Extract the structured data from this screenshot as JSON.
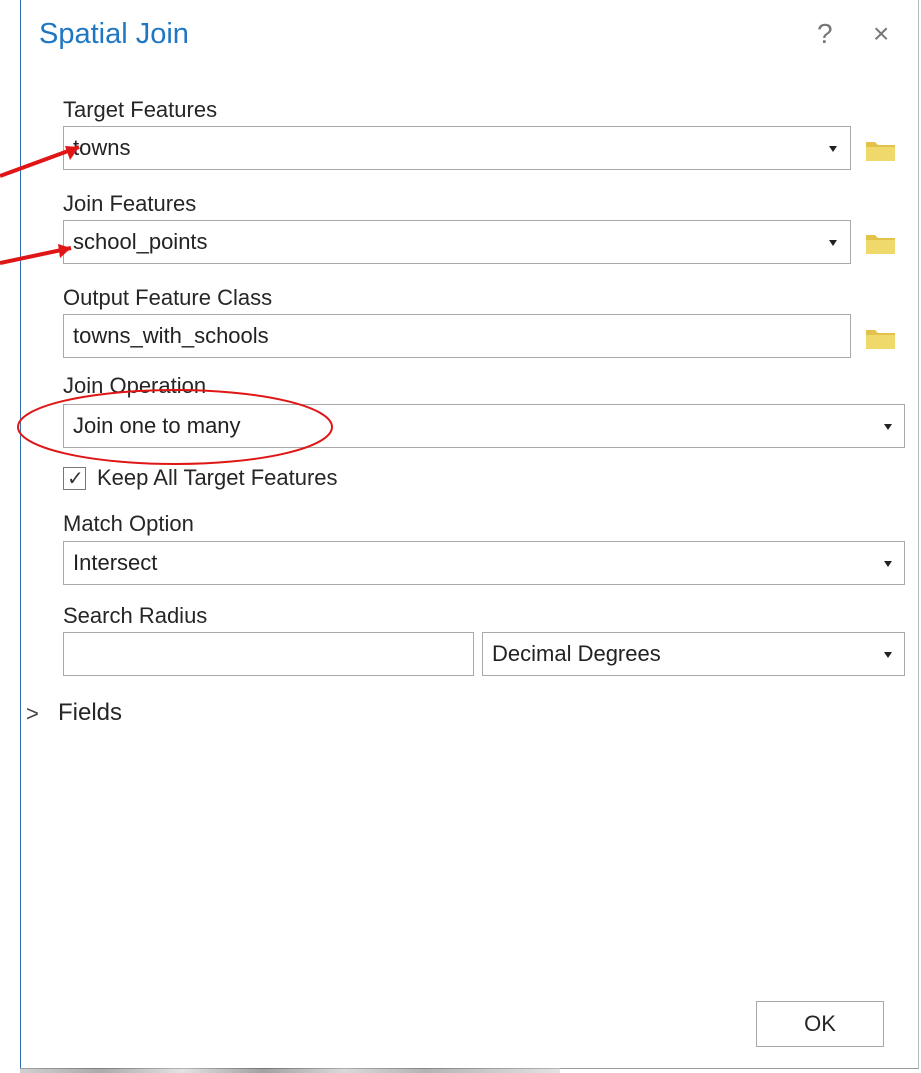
{
  "dialog": {
    "title": "Spatial Join",
    "help_label": "?",
    "close_label": "×",
    "target_label": "Target Features",
    "target_value": "towns",
    "join_label": "Join Features",
    "join_value": "school_points",
    "output_label": "Output Feature Class",
    "output_value": "towns_with_schools",
    "operation_label": "Join Operation",
    "operation_value": "Join one to many",
    "keep_label": "Keep All Target Features",
    "keep_checked": "✓",
    "match_label": "Match Option",
    "match_value": "Intersect",
    "search_label": "Search Radius",
    "search_value": "",
    "unit_value": "Decimal Degrees",
    "fields_chevron": ">",
    "fields_label": "Fields",
    "ok_label": "OK"
  },
  "colors": {
    "title": "#1f77c4",
    "annotation": "#e01616",
    "folder": "#e8c94e"
  },
  "icons": [
    "question-icon",
    "close-icon",
    "dropdown-caret-icon",
    "folder-icon",
    "checkmark-icon",
    "chevron-right-icon"
  ]
}
